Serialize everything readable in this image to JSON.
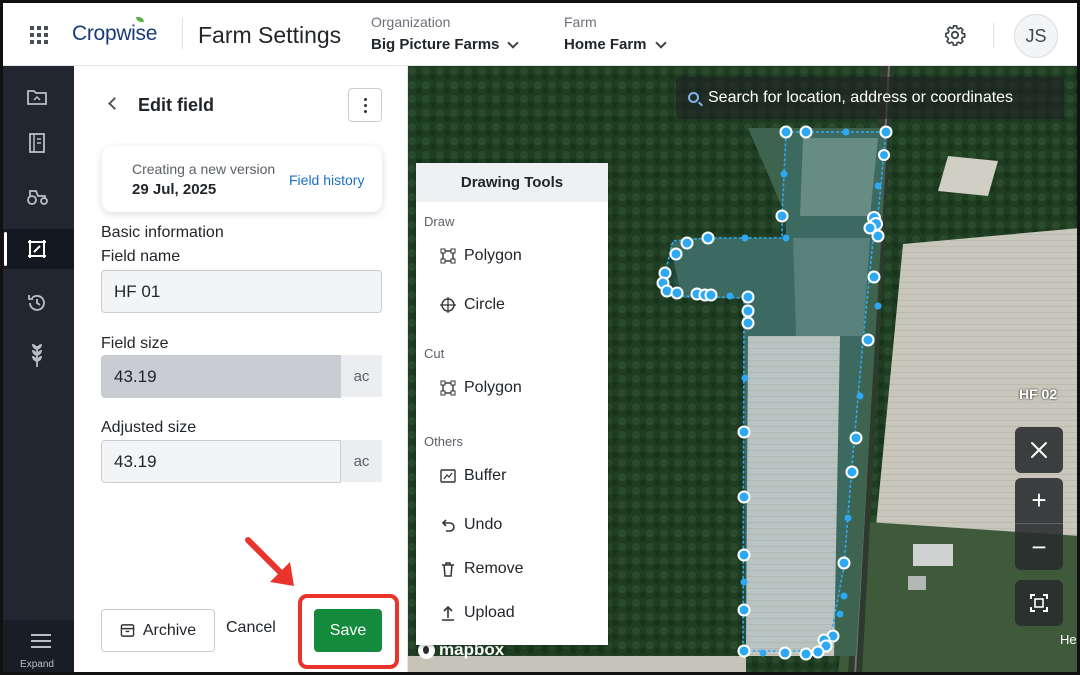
{
  "header": {
    "logo": "Cropwise",
    "app_title": "Farm Settings",
    "organization_label": "Organization",
    "organization_value": "Big Picture Farms",
    "farm_label": "Farm",
    "farm_value": "Home Farm",
    "user_initials": "JS"
  },
  "nav": {
    "items": [
      "folder-icon",
      "book-icon",
      "tractor-icon",
      "field-edit-icon",
      "history-icon",
      "crop-icon"
    ],
    "active_index": 3,
    "expand_label": "Expand"
  },
  "panel": {
    "title": "Edit field",
    "version_label": "Creating a new version",
    "version_date": "29 Jul, 2025",
    "field_history_link": "Field history",
    "basic_info_heading": "Basic information",
    "field_name_label": "Field name",
    "field_name_value": "HF 01",
    "field_size_label": "Field size",
    "field_size_value": "43.19",
    "field_size_unit": "ac",
    "adjusted_size_label": "Adjusted size",
    "adjusted_size_value": "43.19",
    "adjusted_size_unit": "ac",
    "archive_label": "Archive",
    "cancel_label": "Cancel",
    "save_label": "Save"
  },
  "map": {
    "search_placeholder": "Search for location, address or coordinates",
    "other_field_label": "HF 02",
    "attribution": "mapbox",
    "edge_text": "Her",
    "polygon_color": "#2ea8f2",
    "highlight_color": "#e9332b"
  },
  "drawing_tools": {
    "title": "Drawing Tools",
    "draw_group": "Draw",
    "draw_polygon": "Polygon",
    "draw_circle": "Circle",
    "cut_group": "Cut",
    "cut_polygon": "Polygon",
    "others_group": "Others",
    "buffer": "Buffer",
    "undo": "Undo",
    "remove": "Remove",
    "upload": "Upload"
  }
}
